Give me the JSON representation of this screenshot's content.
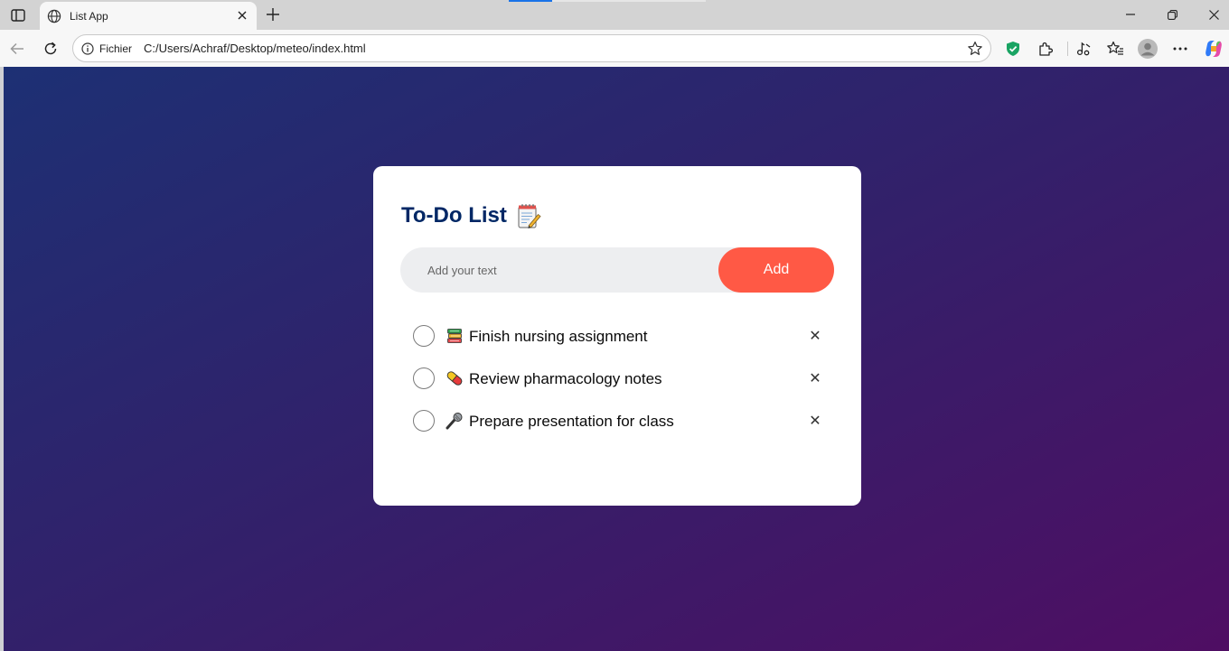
{
  "browser": {
    "tab": {
      "title": "List App"
    },
    "address": {
      "scheme_label": "Fichier",
      "url": "C:/Users/Achraf/Desktop/meteo/index.html"
    }
  },
  "app": {
    "title": "To-Do List",
    "input": {
      "placeholder": "Add your text",
      "value": ""
    },
    "add_button": "Add",
    "tasks": [
      {
        "icon": "books-icon",
        "text": "Finish nursing assignment",
        "done": false
      },
      {
        "icon": "pill-icon",
        "text": "Review pharmacology notes",
        "done": false
      },
      {
        "icon": "microphone-icon",
        "text": "Prepare presentation for class",
        "done": false
      }
    ],
    "delete_glyph": "✕"
  },
  "colors": {
    "title": "#002765",
    "add_button": "#ff5945",
    "input_bg": "#edeef0",
    "gradient_start": "#1d3074",
    "gradient_end": "#4f0e63"
  }
}
